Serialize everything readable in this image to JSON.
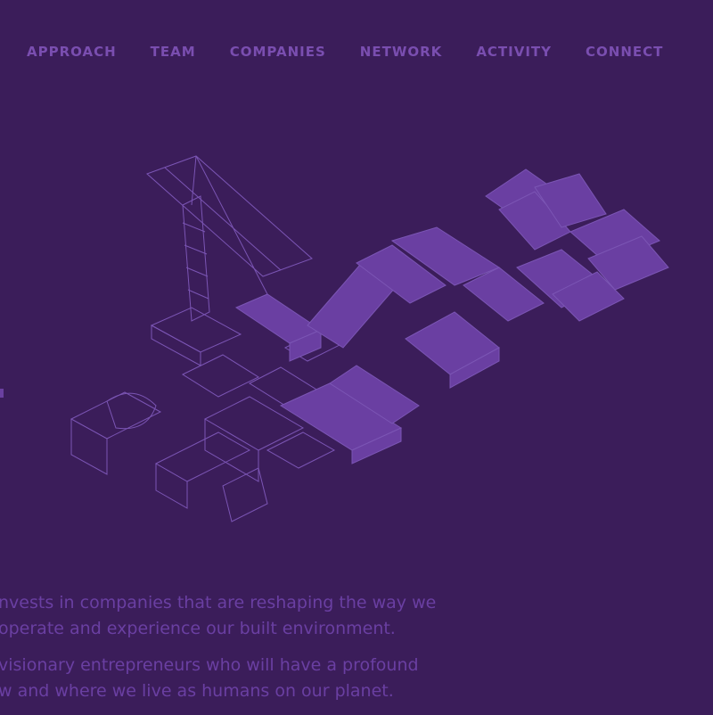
{
  "nav": {
    "items": [
      "APPROACH",
      "TEAM",
      "COMPANIES",
      "NETWORK",
      "ACTIVITY",
      "CONNECT"
    ]
  },
  "hero": {
    "illustration_icon": "isometric-crane-and-letters-icon",
    "colors": {
      "fill": "#6a3fa2",
      "outline": "#7b55b4"
    }
  },
  "copy": {
    "line1": "nvests in companies that are reshaping the way we",
    "line2": "operate and experience our built environment.",
    "line3": "visionary entrepreneurs who will have a profound",
    "line4": "w and where we live as humans on our planet."
  }
}
